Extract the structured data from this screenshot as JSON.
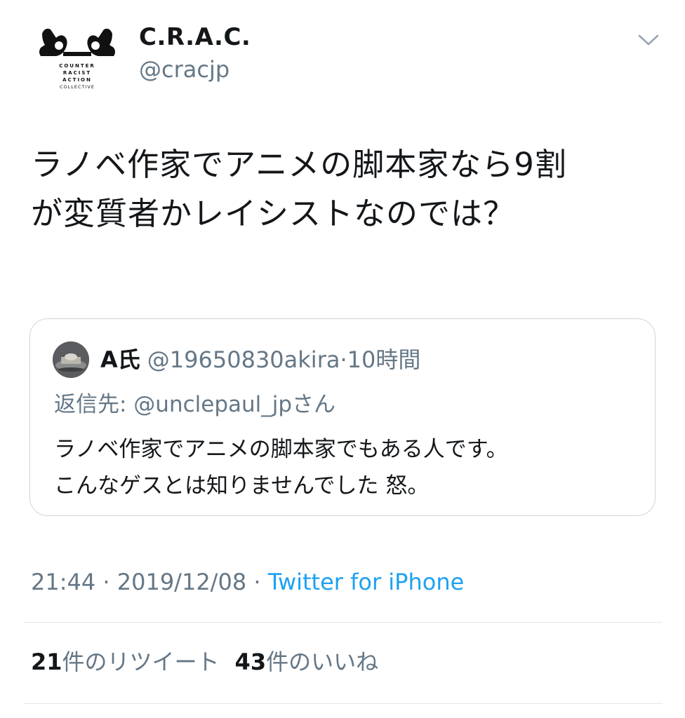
{
  "author": {
    "name": "C.R.A.C.",
    "handle": "@cracjp",
    "avatar_text": [
      "COUNTER",
      "RACIST",
      "ACTION",
      "COLLECTIVE"
    ]
  },
  "tweet": {
    "lines": [
      "ラノベ作家でアニメの脚本家なら9割",
      "が変質者かレイシストなのでは？"
    ]
  },
  "quoted": {
    "name": "A氏",
    "handle": "@19650830akira",
    "separator": "·",
    "time": "10時間",
    "reply_to": "返信先: @unclepaul_jpさん",
    "lines": [
      "ラノベ作家でアニメの脚本家でもある人です。",
      "こんなゲスとは知りませんでした 怒。"
    ]
  },
  "meta": {
    "time": "21:44",
    "separator": "·",
    "date": "2019/12/08",
    "client": "Twitter for iPhone"
  },
  "stats": {
    "retweet_count": "21",
    "retweet_label": "件のリツイート",
    "like_count": "43",
    "like_label": "件のいいね"
  },
  "colors": {
    "text": "#14171a",
    "secondary": "#657786",
    "link": "#1da1f2",
    "border": "#ccd6dd"
  }
}
